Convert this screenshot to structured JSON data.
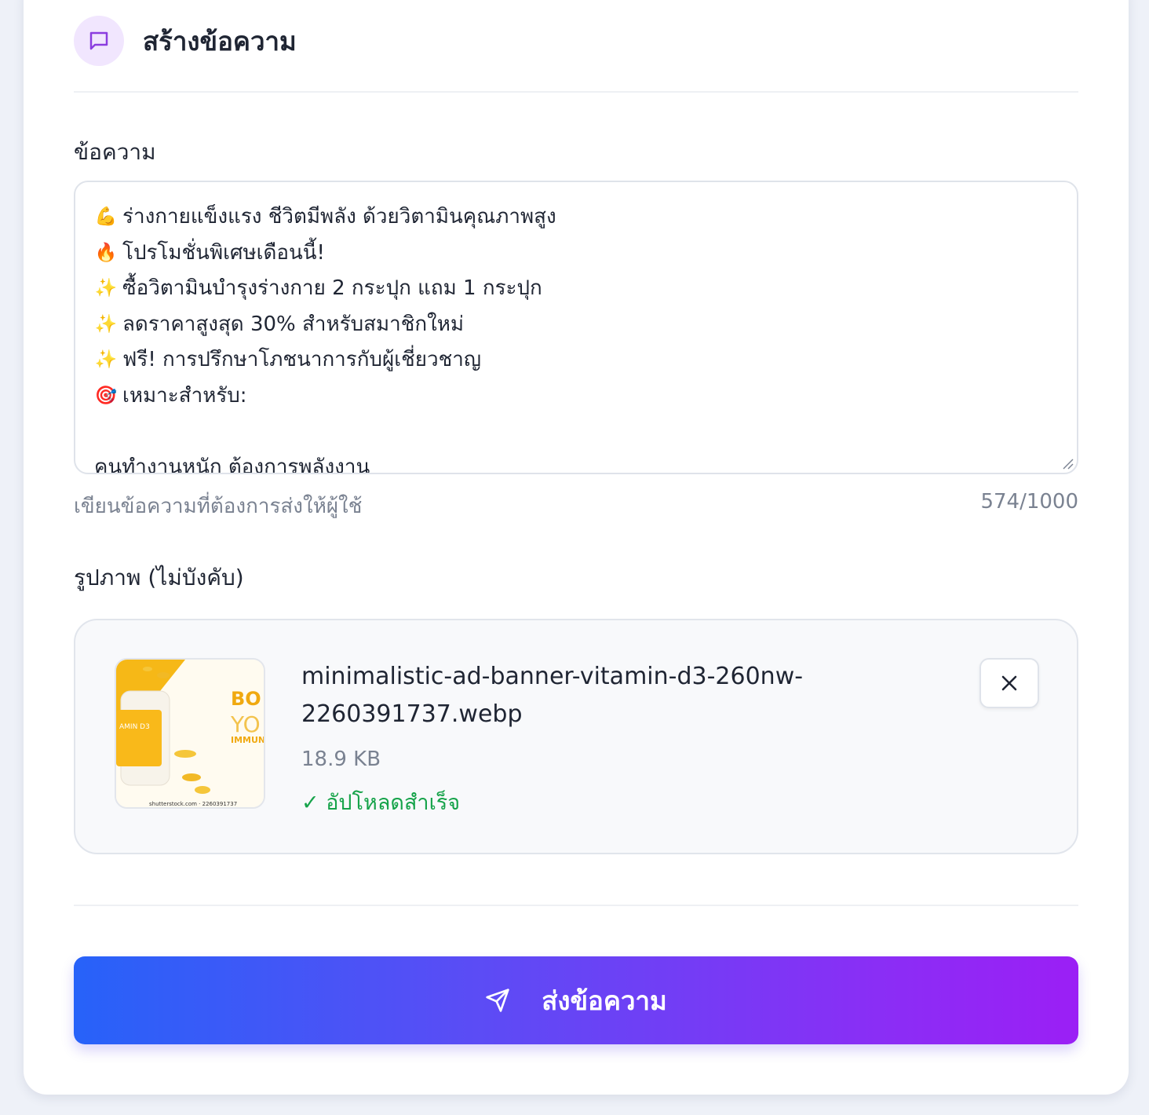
{
  "header": {
    "title": "สร้างข้อความ",
    "icon": "message-square-icon"
  },
  "message": {
    "label": "ข้อความ",
    "lines": [
      {
        "emoji": "💪",
        "text": "ร่างกายแข็งแรง ชีวิตมีพลัง ด้วยวิตามินคุณภาพสูง"
      },
      {
        "emoji": "🔥",
        "text": "โปรโมชั่นพิเศษเดือนนี้!"
      },
      {
        "emoji": "✨",
        "text": "ซื้อวิตามินบำรุงร่างกาย 2 กระปุก แถม 1 กระปุก"
      },
      {
        "emoji": "✨",
        "text": "ลดราคาสูงสุด 30% สำหรับสมาชิกใหม่"
      },
      {
        "emoji": "✨",
        "text": "ฟรี! การปรึกษาโภชนาการกับผู้เชี่ยวชาญ"
      },
      {
        "emoji": "🎯",
        "text": "เหมาะสำหรับ:"
      },
      {
        "emoji": "",
        "text": ""
      },
      {
        "emoji": "",
        "text": "คนทำงานหนัก ต้องการพลังงาน"
      }
    ],
    "helper": "เขียนข้อความที่ต้องการส่งให้ผู้ใช้",
    "counter": "574/1000"
  },
  "image": {
    "label": "รูปภาพ (ไม่บังคับ)",
    "file_name": "minimalistic-ad-banner-vitamin-d3-260nw-2260391737.webp",
    "file_size": "18.9 KB",
    "status": "✓ อัปโหลดสำเร็จ",
    "thumb_text": {
      "brand": "BO",
      "line2": "YO",
      "line3": "IMMUN",
      "bottle": "AMIN D3",
      "watermark": "shutterstock.com · 2260391737"
    }
  },
  "send_button": {
    "label": "ส่งข้อความ"
  },
  "colors": {
    "accent": "#7c3aed",
    "success": "#16a34a",
    "gradient_start": "#2762f9",
    "gradient_end": "#9b1ff5"
  }
}
